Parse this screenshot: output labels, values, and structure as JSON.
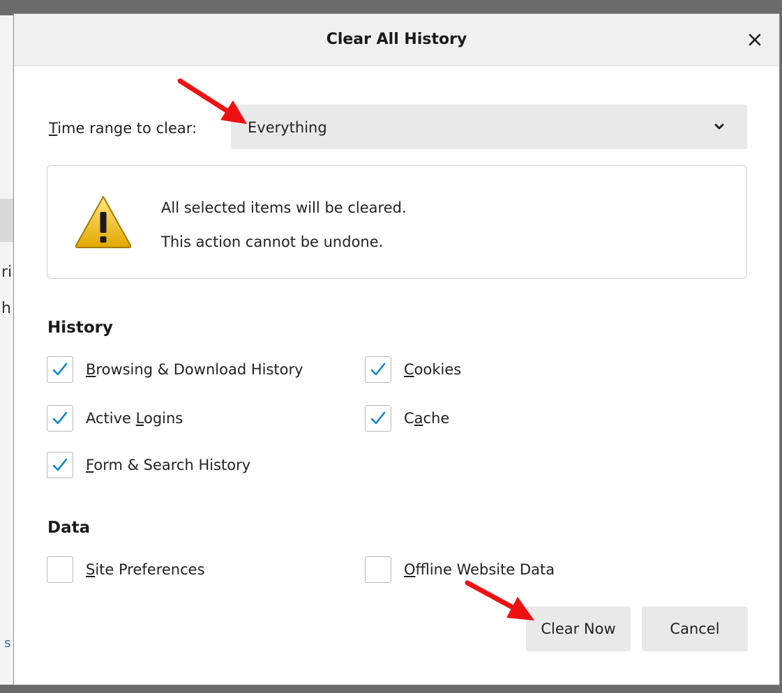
{
  "dialog": {
    "title": "Clear All History",
    "close_icon": "close-icon"
  },
  "time_range": {
    "label_first": "T",
    "label_rest": "ime range to clear:",
    "selected": "Everything",
    "icon": "chevron-down-icon"
  },
  "warning": {
    "icon": "warning-icon",
    "line1": "All selected items will be cleared.",
    "line2": "This action cannot be undone."
  },
  "history": {
    "title": "History",
    "items": [
      {
        "pre": "",
        "ul": "B",
        "post": "rowsing & Download History",
        "checked": true
      },
      {
        "pre": "",
        "ul": "C",
        "post": "ookies",
        "checked": true
      },
      {
        "pre": "Active ",
        "ul": "L",
        "post": "ogins",
        "checked": true
      },
      {
        "pre": "C",
        "ul": "a",
        "post": "che",
        "checked": true
      },
      {
        "pre": "",
        "ul": "F",
        "post": "orm & Search History",
        "checked": true
      }
    ]
  },
  "data": {
    "title": "Data",
    "items": [
      {
        "pre": "",
        "ul": "S",
        "post": "ite Preferences",
        "checked": false
      },
      {
        "pre": "",
        "ul": "O",
        "post": "ffline Website Data",
        "checked": false
      }
    ]
  },
  "buttons": {
    "clear_now": "Clear Now",
    "cancel": "Cancel"
  },
  "colors": {
    "check": "#0a84c6",
    "annotation_arrow": "#ee1111"
  }
}
